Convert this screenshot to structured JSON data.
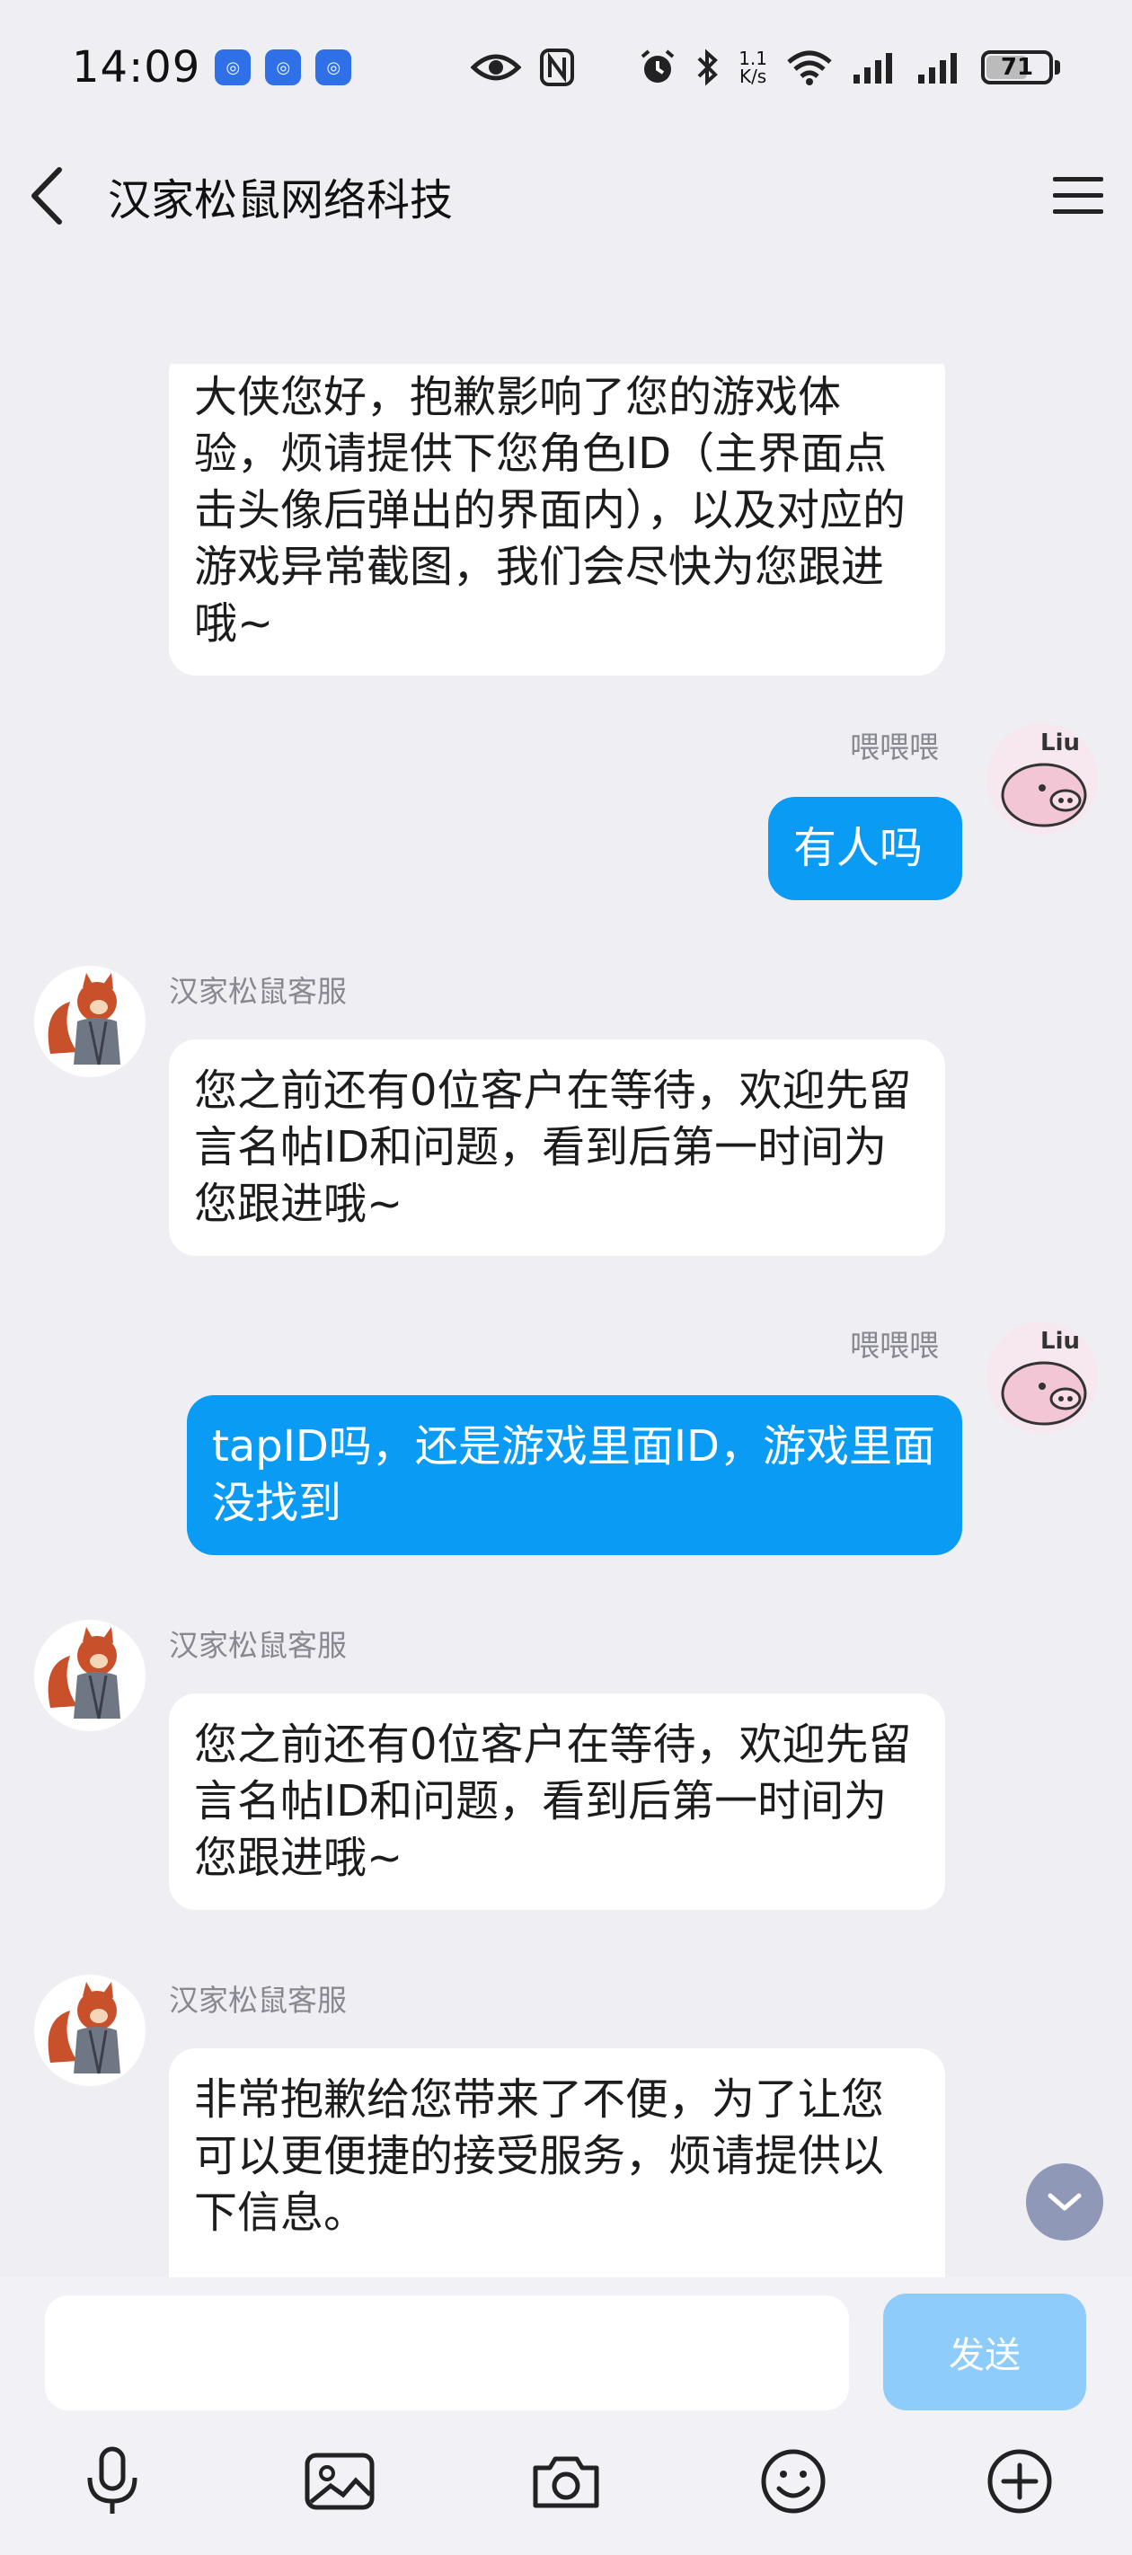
{
  "status_bar": {
    "time": "14:09",
    "app_badges": [
      "app-badge",
      "app-badge",
      "app-badge"
    ],
    "net_speed_value": "1.1",
    "net_speed_unit": "K/s",
    "network": "6",
    "battery": "71"
  },
  "header": {
    "title": "汉家松鼠网络科技"
  },
  "messages": [
    {
      "side": "in",
      "sender": "",
      "text": "大侠您好，抱歉影响了您的游戏体验，烦请提供下您角色ID（主界面点击头像后弹出的界面内），以及对应的游戏异常截图，我们会尽快为您跟进哦~"
    },
    {
      "side": "out",
      "sender": "喂喂喂",
      "text": "有人吗"
    },
    {
      "side": "in",
      "sender": "汉家松鼠客服",
      "text": "您之前还有0位客户在等待，欢迎先留言名帖ID和问题，看到后第一时间为您跟进哦~"
    },
    {
      "side": "out",
      "sender": "喂喂喂",
      "text": "tapID吗，还是游戏里面ID，游戏里面没找到"
    },
    {
      "side": "in",
      "sender": "汉家松鼠客服",
      "text": "您之前还有0位客户在等待，欢迎先留言名帖ID和问题，看到后第一时间为您跟进哦~"
    },
    {
      "side": "in",
      "sender": "汉家松鼠客服",
      "text": "非常抱歉给您带来了不便，为了让您可以更便捷的接受服务，烦请提供以下信息。"
    }
  ],
  "user_avatar_text": "Liu",
  "input": {
    "value": "",
    "placeholder": ""
  },
  "send_label": "发送",
  "toolbar": [
    "microphone-icon",
    "image-icon",
    "camera-icon",
    "emoji-icon",
    "plus-icon"
  ],
  "colors": {
    "background": "#eeeef3",
    "outgoing_bubble": "#0a9bf5",
    "incoming_bubble": "#ffffff",
    "send_button": "#8ecdfb"
  }
}
